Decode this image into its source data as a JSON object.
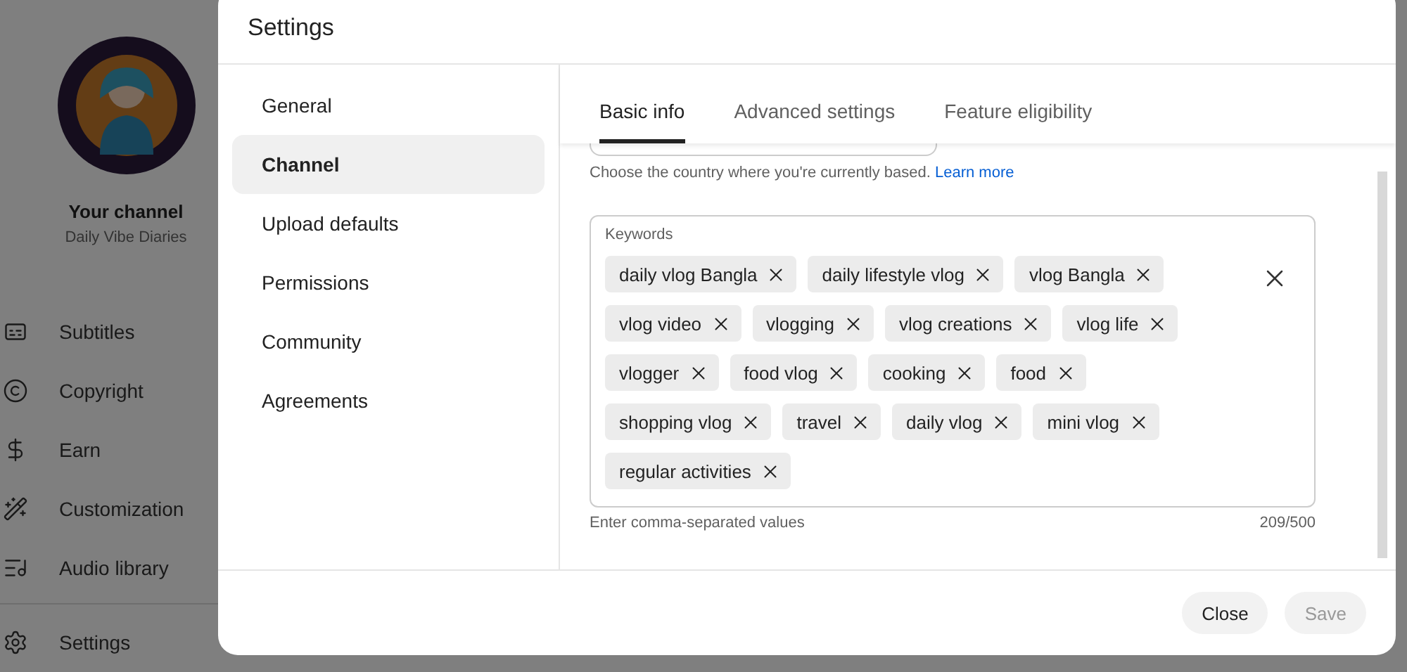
{
  "background": {
    "channel": {
      "title": "Your channel",
      "name": "Daily Vibe Diaries"
    },
    "nav": [
      {
        "label": "Subtitles",
        "kind": "subtitles"
      },
      {
        "label": "Copyright",
        "kind": "copyright"
      },
      {
        "label": "Earn",
        "kind": "earn"
      },
      {
        "label": "Customization",
        "kind": "wand"
      },
      {
        "label": "Audio library",
        "kind": "audio"
      }
    ],
    "bottom_nav": [
      {
        "label": "Settings",
        "kind": "settings"
      }
    ]
  },
  "dialog": {
    "title": "Settings",
    "sections": [
      {
        "label": "General",
        "selected": false
      },
      {
        "label": "Channel",
        "selected": true
      },
      {
        "label": "Upload defaults",
        "selected": false
      },
      {
        "label": "Permissions",
        "selected": false
      },
      {
        "label": "Community",
        "selected": false
      },
      {
        "label": "Agreements",
        "selected": false
      }
    ],
    "tabs": [
      {
        "label": "Basic info",
        "selected": true
      },
      {
        "label": "Advanced settings",
        "selected": false
      },
      {
        "label": "Feature eligibility",
        "selected": false
      }
    ],
    "country_hint": "Choose the country where you're currently based.",
    "country_link": "Learn more",
    "keywords": {
      "label": "Keywords",
      "chips": [
        [
          "daily vlog Bangla",
          "daily lifestyle vlog",
          "vlog Bangla"
        ],
        [
          "vlog video",
          "vlogging",
          "vlog creations",
          "vlog life"
        ],
        [
          "vlogger",
          "food vlog",
          "cooking",
          "food"
        ],
        [
          "shopping vlog",
          "travel",
          "daily vlog",
          "mini vlog"
        ],
        [
          "regular activities"
        ]
      ],
      "hint": "Enter comma-separated values",
      "count": "209/500"
    },
    "buttons": [
      {
        "label": "Close",
        "disabled": false
      },
      {
        "label": "Save",
        "disabled": true
      }
    ]
  }
}
